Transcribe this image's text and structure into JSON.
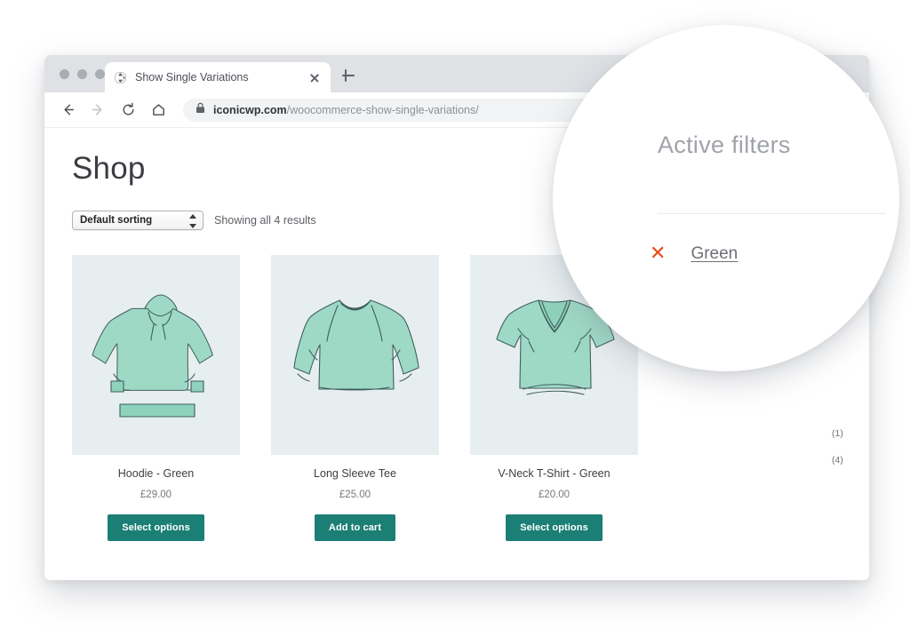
{
  "browser": {
    "tab": {
      "title": "Show Single Variations",
      "favicon": "globe-icon",
      "close_label": "×"
    },
    "new_tab_label": "+",
    "address": {
      "secure_icon": "lock-icon",
      "domain": "iconicwp.com",
      "path": "/woocommerce-show-single-variations/"
    },
    "nav": {
      "back": "back-arrow-icon",
      "forward": "forward-arrow-icon",
      "reload": "reload-icon",
      "home": "home-icon",
      "menu": "kebab-menu-icon"
    }
  },
  "page": {
    "title": "Shop",
    "sorting": {
      "selected": "Default sorting"
    },
    "results_text": "Showing all 4 results",
    "products": [
      {
        "name": "Hoodie - Green",
        "price": "£29.00",
        "button": "Select options",
        "image": "hoodie-illustration"
      },
      {
        "name": "Long Sleeve Tee",
        "price": "£25.00",
        "button": "Add to cart",
        "image": "long-sleeve-tee-illustration"
      },
      {
        "name": "V-Neck T-Shirt - Green",
        "price": "£20.00",
        "button": "Select options",
        "image": "vneck-tshirt-illustration"
      }
    ]
  },
  "sidebar": {
    "title": "Active filters",
    "active_filter": {
      "remove_icon": "✕",
      "label": "Green"
    },
    "counts": [
      "(1)",
      "(4)"
    ]
  },
  "magnifier": {
    "title": "Active filters",
    "remove_icon": "✕",
    "filter_label": "Green"
  },
  "colors": {
    "button_teal": "#1b7f75",
    "remove_x_orange": "#e8491f",
    "product_bg": "#e7eef0",
    "chrome_gray": "#dfe1e5",
    "garment_mint": "#9ed9c5"
  }
}
